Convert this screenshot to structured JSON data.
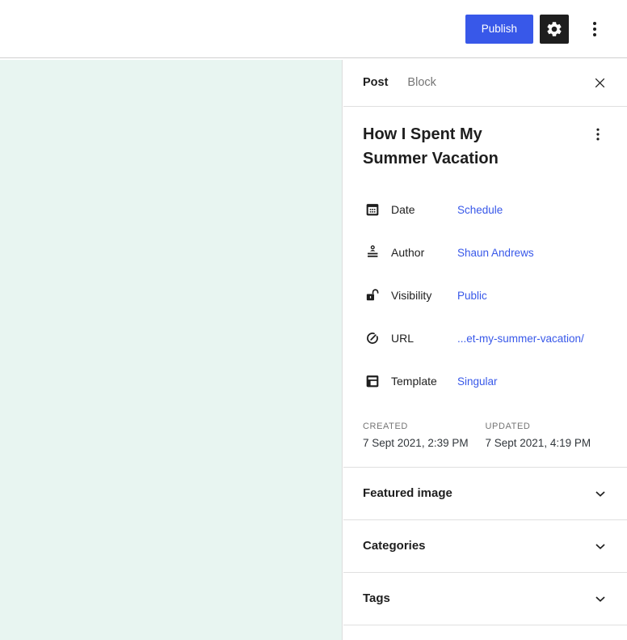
{
  "topbar": {
    "publish_label": "Publish"
  },
  "sidebar": {
    "tabs": [
      {
        "label": "Post",
        "active": true
      },
      {
        "label": "Block",
        "active": false
      }
    ],
    "summary": {
      "title": "How I Spent My Summer Vacation",
      "rows": [
        {
          "icon": "calendar-icon",
          "label": "Date",
          "value": "Schedule"
        },
        {
          "icon": "author-icon",
          "label": "Author",
          "value": "Shaun Andrews"
        },
        {
          "icon": "unlock-icon",
          "label": "Visibility",
          "value": "Public"
        },
        {
          "icon": "link-icon",
          "label": "URL",
          "value": "...et-my-summer-vacation/"
        },
        {
          "icon": "template-icon",
          "label": "Template",
          "value": "Singular"
        }
      ],
      "meta": [
        {
          "label": "CREATED",
          "value": "7 Sept 2021, 2:39 PM"
        },
        {
          "label": "UPDATED",
          "value": "7 Sept 2021, 4:19 PM"
        }
      ]
    },
    "panels": [
      {
        "title": "Featured image"
      },
      {
        "title": "Categories"
      },
      {
        "title": "Tags"
      }
    ]
  },
  "colors": {
    "accent": "#3858e9",
    "canvas": "#e8f5f1",
    "dark_button": "#1e1e1e",
    "divider": "#e0e0e0",
    "muted": "#757575"
  }
}
